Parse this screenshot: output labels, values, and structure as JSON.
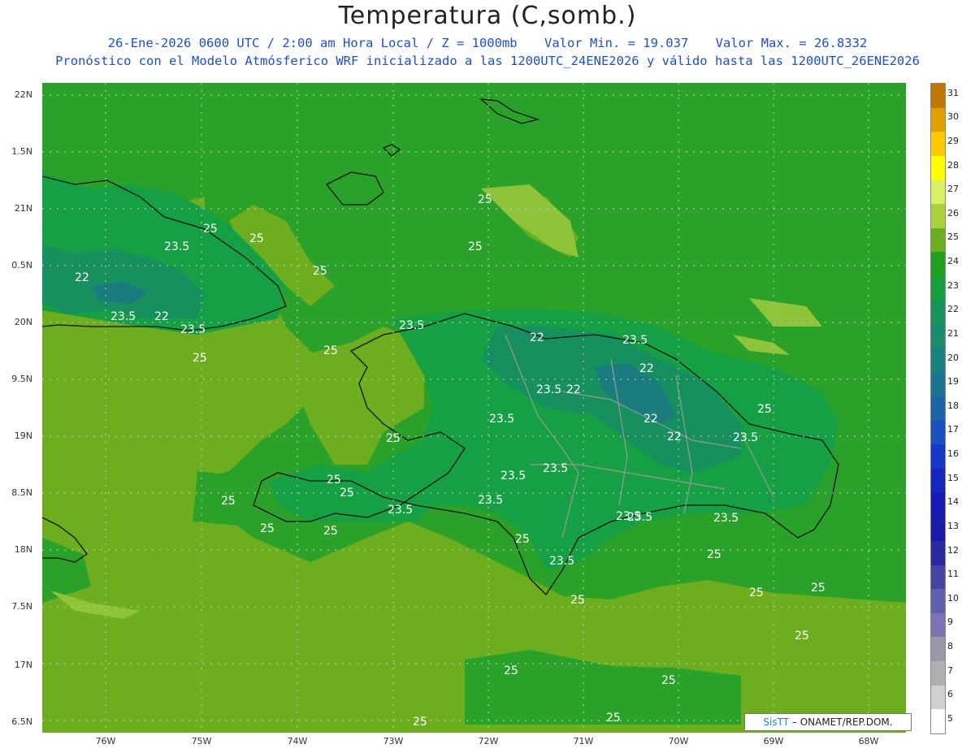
{
  "title": "Temperatura (C,somb.)",
  "subtitle": {
    "valid_time": "26-Ene-2026  0600 UTC / 2:00 am Hora Local / Z = 1000mb",
    "min": "Valor Min. = 19.037",
    "max": "Valor Max. = 26.8332",
    "model_info": "Pronóstico con el Modelo Atmósferico WRF inicializado a las 1200UTC_24ENE2026 y válido hasta las  1200UTC_26ENE2026"
  },
  "lat_labels": [
    "22N",
    "1.5N",
    "21N",
    "0.5N",
    "20N",
    "9.5N",
    "19N",
    "8.5N",
    "18N",
    "7.5N",
    "17N",
    "6.5N"
  ],
  "lon_labels": [
    "76W",
    "75W",
    "74W",
    "73W",
    "72W",
    "71W",
    "70W",
    "69W",
    "68W"
  ],
  "colorbar": {
    "labels": [
      "31",
      "30",
      "29",
      "28",
      "27",
      "26",
      "25",
      "24",
      "23",
      "22",
      "21",
      "20",
      "19",
      "18",
      "17",
      "16",
      "15",
      "14",
      "13",
      "12",
      "11",
      "10",
      "9",
      "8",
      "7",
      "6",
      "5"
    ],
    "colors": [
      "#c07800",
      "#e0a000",
      "#ffc800",
      "#ffff00",
      "#dcf064",
      "#a8d23c",
      "#6cae1e",
      "#1fa01f",
      "#14a040",
      "#18945a",
      "#1a8c6e",
      "#1b8080",
      "#1a7490",
      "#1b64a8",
      "#1a50c0",
      "#1638c8",
      "#1428c0",
      "#1818b4",
      "#1a1aa8",
      "#2a2aa0",
      "#4444a4",
      "#6060ac",
      "#8070b4",
      "#9898a8",
      "#b0b0b0",
      "#d0d0d0",
      "#ffffff"
    ]
  },
  "contour_labels": [
    "25",
    "25",
    "25",
    "25",
    "25",
    "23.5",
    "22",
    "22",
    "23.5",
    "23.5",
    "25",
    "25",
    "23.5",
    "22",
    "23.5",
    "22",
    "23.5",
    "22",
    "22",
    "23.5",
    "23.5",
    "25",
    "23.5",
    "23.5",
    "23.5",
    "23.5",
    "22",
    "25",
    "25",
    "25",
    "25",
    "25",
    "23.5",
    "23.5",
    "25",
    "25",
    "25",
    "25",
    "25",
    "25",
    "25",
    "25",
    "23.5",
    "23.5",
    "25",
    "25",
    "25"
  ],
  "credit": {
    "brand": "SisTT",
    "org": "– ONAMET/REP.DOM."
  }
}
